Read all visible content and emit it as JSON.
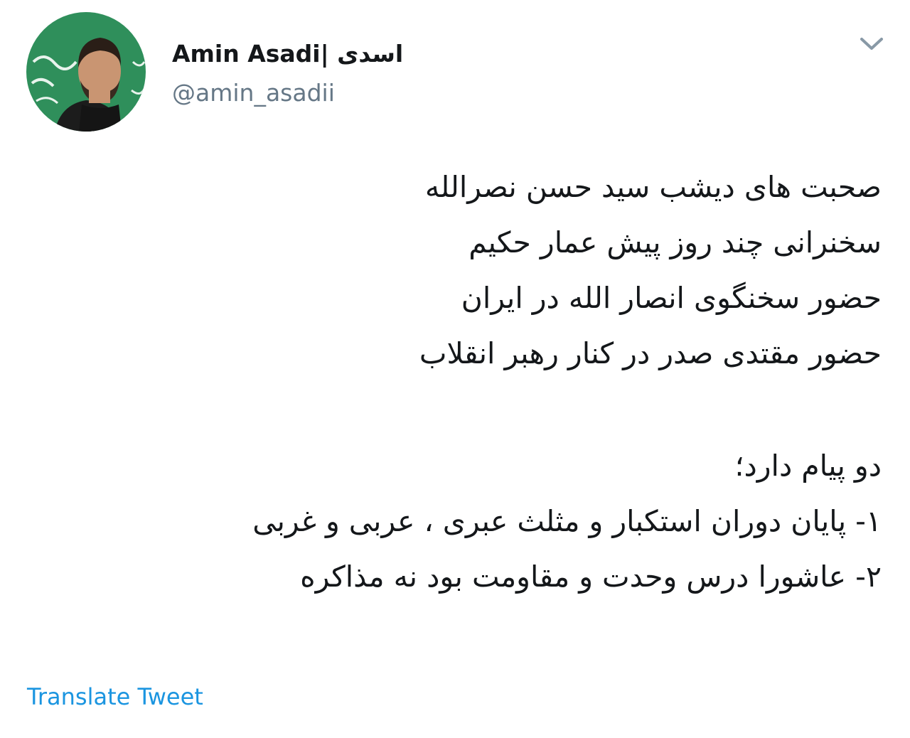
{
  "user": {
    "display_name": "Amin Asadi| اسدی",
    "handle": "@amin_asadii",
    "avatar_icon": "profile-photo"
  },
  "menu": {
    "icon": "chevron-down-icon"
  },
  "tweet": {
    "lines_part1": [
      "صحبت های دیشب سید حسن نصرالله",
      "سخنرانی چند روز پیش عمار حکیم",
      "حضور سخنگوی انصار الله در ایران",
      "حضور مقتدی صدر در کنار رهبر انقلاب"
    ],
    "lines_part2": [
      "دو پیام دارد؛",
      "۱- پایان دوران استکبار و مثلث عبری ، عربی و غربی",
      "۲- عاشورا درس وحدت و مقاومت بود نه مذاکره"
    ]
  },
  "translate_label": "Translate Tweet",
  "colors": {
    "text": "#14171a",
    "secondary": "#657786",
    "link": "#1b95e0",
    "avatar_bg": "#2e8b57"
  }
}
